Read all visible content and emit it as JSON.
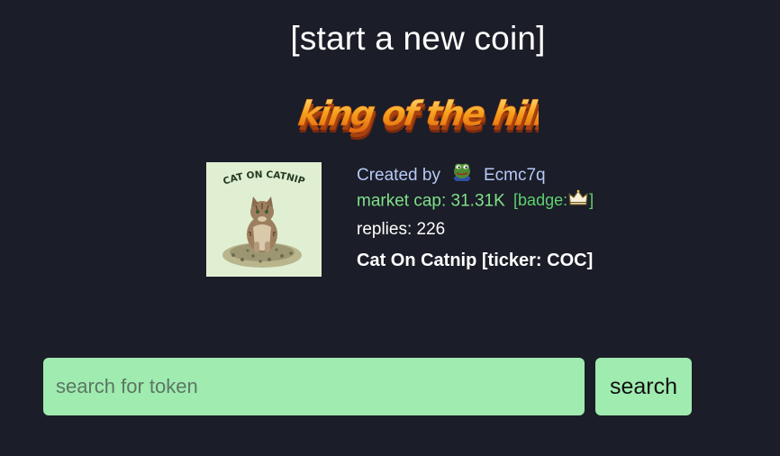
{
  "header": {
    "start_link": "[start a new coin]",
    "banner_text": "king of the hill"
  },
  "featured_coin": {
    "image_caption": "CAT ON CATNIP",
    "created_by_label": "Created by",
    "creator_avatar_icon": "pepe-frog-icon",
    "creator": "Ecmc7q",
    "market_cap_label": "market cap: 31.31K",
    "badge_prefix": "[badge:",
    "badge_icon": "crown-icon",
    "badge_suffix": "]",
    "replies_label": "replies: 226",
    "name_ticker": "Cat On Catnip [ticker: COC]"
  },
  "search": {
    "placeholder": "search for token",
    "value": "",
    "button_label": "search"
  },
  "colors": {
    "background": "#1b1d28",
    "accent_green": "#a0ebb0",
    "market_cap_green": "#7fe08a",
    "creator_blue": "#b6c9f5",
    "banner_orange": "#f08a1c"
  }
}
